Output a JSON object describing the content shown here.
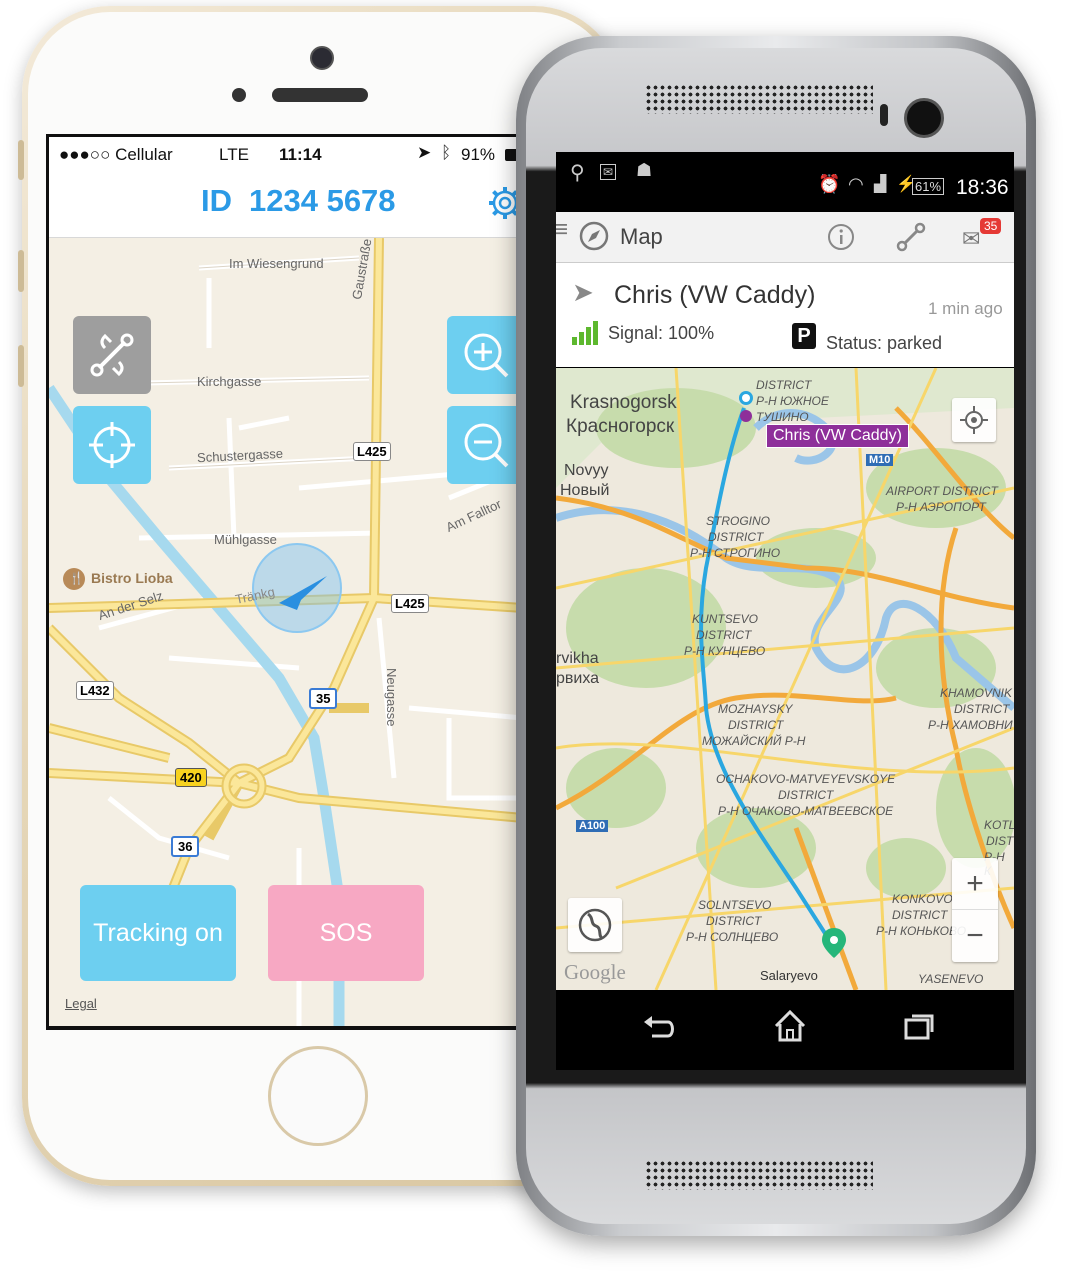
{
  "ios": {
    "status": {
      "carrier": "●●●○○ Cellular",
      "network": "LTE",
      "time": "11:14",
      "battery": "91%"
    },
    "header": {
      "id_label": "ID",
      "id_number": "1234 5678",
      "settings_icon": "gear-icon"
    },
    "map": {
      "labels": {
        "im_wiesengrund": "Im Wiesengrund",
        "gaustrasse": "Gaustraße",
        "kirchgasse": "Kirchgasse",
        "schustergasse": "Schustergasse",
        "muhlgasse": "Mühlgasse",
        "am_falltor": "Am Falltor",
        "bistro": "Bistro Lioba",
        "an_der_selz": "An der Selz",
        "trankgasse": "Tränkg",
        "neugasse": "Neugasse",
        "legal": "Legal"
      },
      "shields": {
        "l425_a": "L425",
        "l425_b": "L425",
        "l432": "L432",
        "r35": "35",
        "r420": "420",
        "r36": "36"
      }
    },
    "buttons": {
      "tracking": "Tracking on",
      "sos": "SOS"
    },
    "colors": {
      "accent": "#2b9ae6",
      "tracking_bg": "#6dcff0",
      "sos_bg": "#f7a8c3",
      "route_btn_bg": "#9e9e9e"
    }
  },
  "android": {
    "status": {
      "battery": "61%",
      "time": "18:36"
    },
    "actionbar": {
      "title": "Map",
      "alert_count": "35"
    },
    "vehicle": {
      "name": "Chris (VW Caddy)",
      "last_seen": "1 min ago",
      "signal": "Signal: 100%",
      "status": "Status: parked",
      "status_icon_letter": "P"
    },
    "map": {
      "callout": "Chris (VW Caddy)",
      "labels": {
        "krasnogorsk_en": "Krasnogorsk",
        "krasnogorsk_ru": "Красногорск",
        "novyy_en": "Novyy",
        "novyy_ru": "Новый",
        "district_top1": "DISTRICT",
        "yuzhnoe": "Р-Н ЮЖНОЕ",
        "tushino": "ТУШИНО",
        "m10": "M10",
        "airport_en": "AIRPORT DISTRICT",
        "airport_ru": "Р-Н АЭРОПОРТ",
        "strogino_en1": "STROGINO",
        "strogino_en2": "DISTRICT",
        "strogino_ru": "Р-Н СТРОГИНО",
        "kuntsevo_en1": "KUNTSEVO",
        "kuntsevo_en2": "DISTRICT",
        "kuntsevo_ru": "Р-Н КУНЦЕВО",
        "rvikha_en": "rvikha",
        "rvikha_ru": "рвиха",
        "khamovniki_en1": "KHAMOVNIK",
        "khamovniki_en2": "DISTRICT",
        "khamovniki_ru": "Р-Н ХАМОВНИ",
        "mozhaysky_en1": "MOZHAYSKY",
        "mozhaysky_en2": "DISTRICT",
        "mozhaysky_ru": "МОЖАЙСКИЙ Р-Н",
        "ochakovo_en1": "OCHAKOVO-MATVEYEVSKOYE",
        "ochakovo_en2": "DISTRICT",
        "ochakovo_ru": "Р-Н ОЧАКОВО-МАТВЕЕВСКОЕ",
        "a100": "A100",
        "kotl1": "KOTL",
        "kotl2": "DIST",
        "kotl3": "Р-Н К",
        "solntsevo_en1": "SOLNTSEVO",
        "solntsevo_en2": "DISTRICT",
        "solntsevo_ru": "Р-Н СОЛНЦЕВО",
        "konkovo_en1": "KONKOVO",
        "konkovo_en2": "DISTRICT",
        "konkovo_ru": "Р-Н КОНЬКОВО",
        "salaryevo": "Salaryevo",
        "yasenevo": "YASENEVO",
        "google": "Google"
      },
      "zoom_in": "+",
      "zoom_out": "−"
    },
    "colors": {
      "route": "#2aa7e0",
      "callout_bg": "#8e2f9a",
      "signal_green": "#5db82e"
    }
  }
}
